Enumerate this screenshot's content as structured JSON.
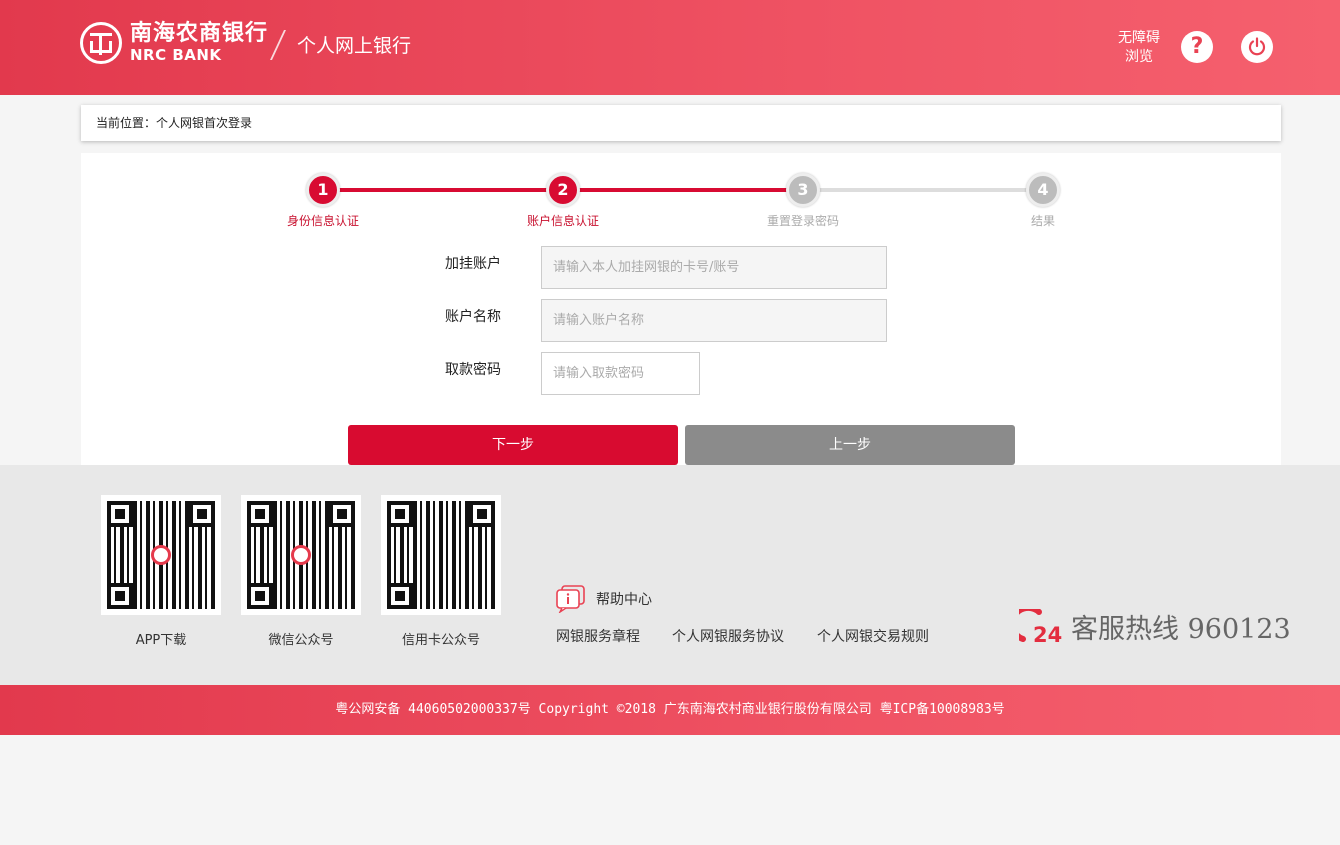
{
  "header": {
    "bank_name_cn": "南海农商银行",
    "bank_name_en": "NRC BANK",
    "subtitle": "个人网上银行",
    "accessibility_label": "无障碍\n浏览",
    "help_symbol": "?",
    "brand_color": "#e94253"
  },
  "breadcrumb": {
    "text": "当前位置：个人网银首次登录"
  },
  "steps": [
    {
      "num": "1",
      "label": "身份信息认证",
      "state": "done"
    },
    {
      "num": "2",
      "label": "账户信息认证",
      "state": "current"
    },
    {
      "num": "3",
      "label": "重置登录密码",
      "state": "pending"
    },
    {
      "num": "4",
      "label": "结果",
      "state": "pending"
    }
  ],
  "form": {
    "account": {
      "label": "加挂账户",
      "placeholder": "请输入本人加挂网银的卡号/账号",
      "value": ""
    },
    "account_name": {
      "label": "账户名称",
      "placeholder": "请输入账户名称",
      "value": ""
    },
    "password": {
      "label": "取款密码",
      "placeholder": "请输入取款密码",
      "value": ""
    },
    "next_label": "下一步",
    "prev_label": "上一步"
  },
  "qr_codes": [
    {
      "label": "APP下载"
    },
    {
      "label": "微信公众号"
    },
    {
      "label": "信用卡公众号"
    }
  ],
  "footer": {
    "help_center": "帮助中心",
    "links": [
      "网银服务章程",
      "个人网银服务协议",
      "个人网银交易规则"
    ],
    "hotline_badge": "24",
    "hotline": "客服热线 960123",
    "copyright": "粤公网安备 44060502000337号 Copyright ©2018 广东南海农村商业银行股份有限公司 粤ICP备10008983号"
  }
}
